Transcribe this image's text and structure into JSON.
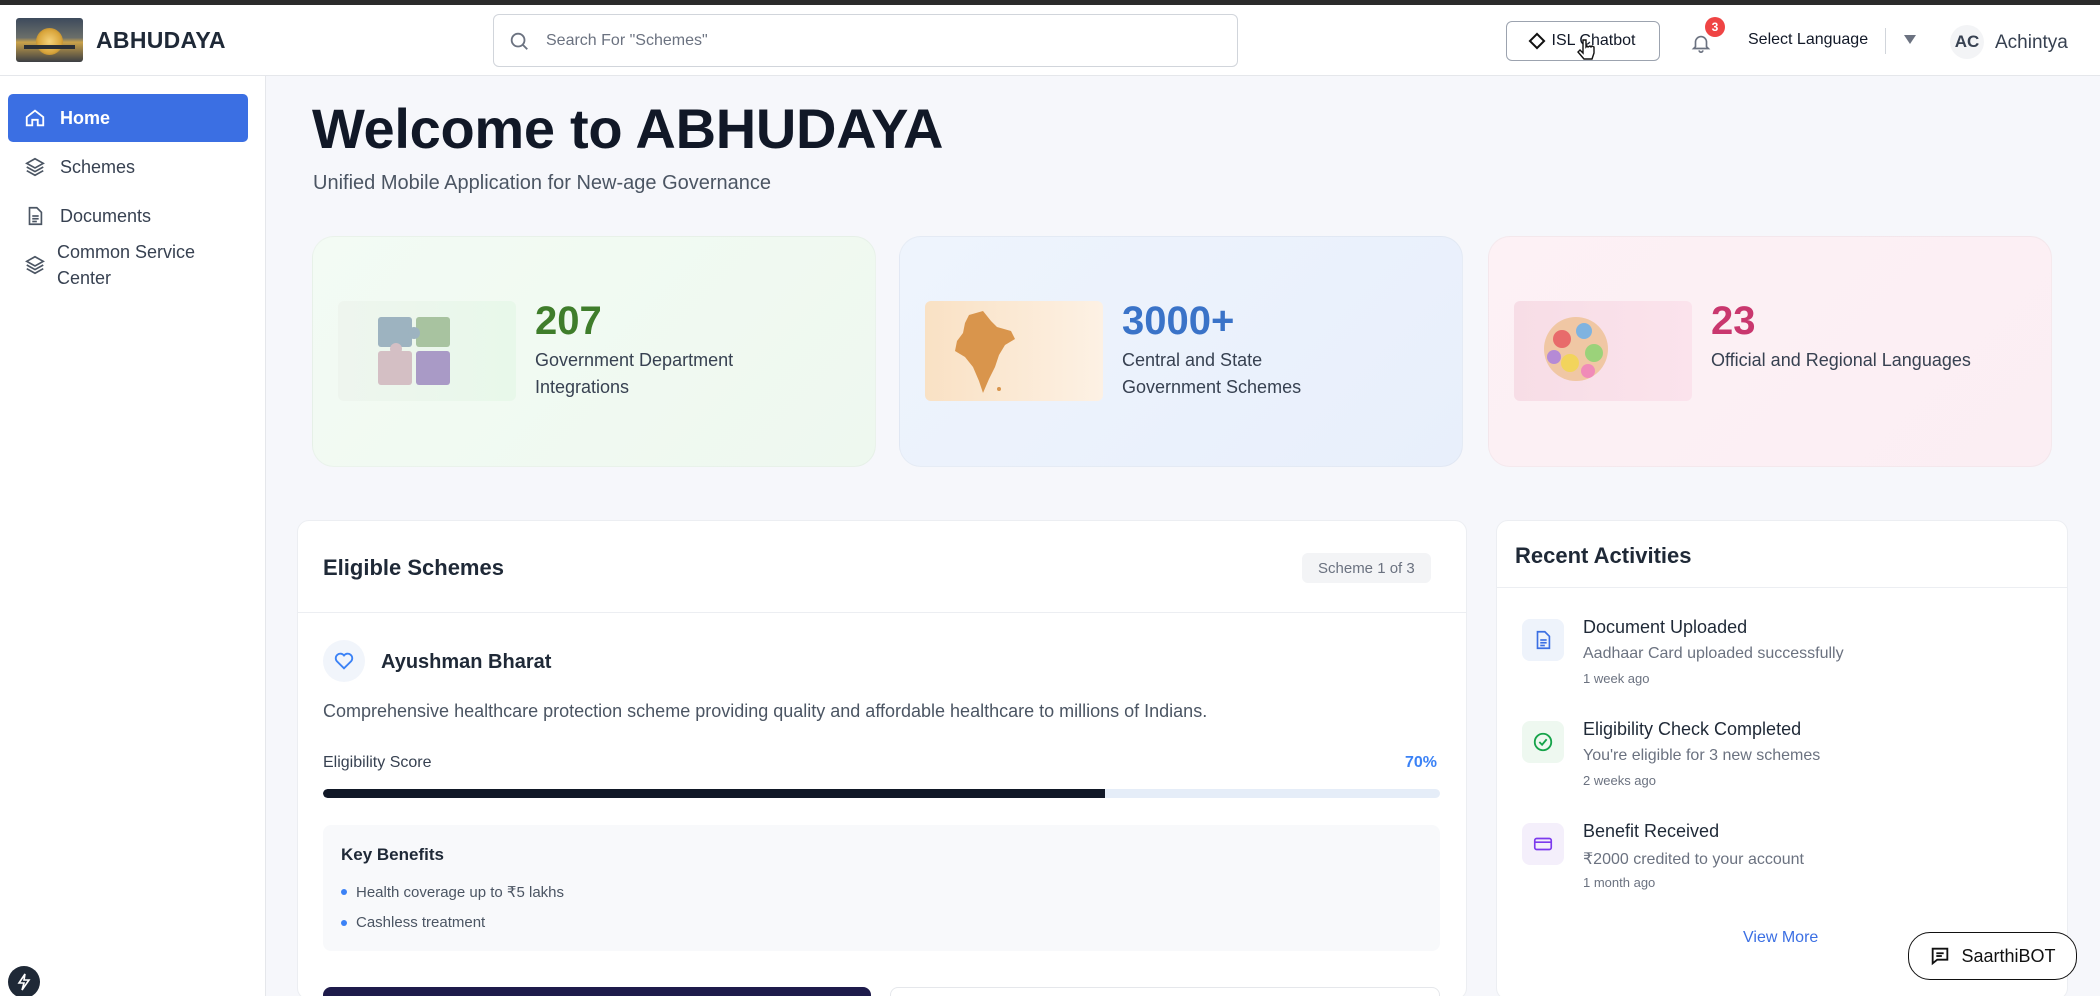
{
  "app": {
    "brand": "ABHUDAYA"
  },
  "header": {
    "search_placeholder": "Search For \"Schemes\"",
    "isl_chatbot_label": "ISL Chatbot",
    "notification_count": "3",
    "language_label": "Select Language",
    "user_initials": "AC",
    "user_name": "Achintya"
  },
  "sidebar": {
    "items": [
      {
        "label": "Home",
        "icon": "home-icon",
        "active": true
      },
      {
        "label": "Schemes",
        "icon": "layers-icon"
      },
      {
        "label": "Documents",
        "icon": "document-icon"
      },
      {
        "label_line1": "Common Service",
        "label_line2": "Center",
        "icon": "layers-icon"
      }
    ]
  },
  "main": {
    "welcome_title": "Welcome to ABHUDAYA",
    "tagline": "Unified Mobile Application for New-age Governance",
    "stats": [
      {
        "value": "207",
        "desc_line1": "Government Department",
        "desc_line2": "Integrations",
        "color": "#3f7d2b",
        "image": "puzzle-pieces"
      },
      {
        "value": "3000+",
        "desc_line1": "Central and State",
        "desc_line2": "Government Schemes",
        "color": "#3a73c8",
        "image": "india-map"
      },
      {
        "value": "23",
        "desc_line1": "Official and Regional Languages",
        "desc_line2": "",
        "color": "#c9376e",
        "image": "speech-bubbles"
      }
    ]
  },
  "eligible": {
    "title": "Eligible Schemes",
    "pager": "Scheme 1 of 3",
    "scheme_name": "Ayushman Bharat",
    "scheme_desc": "Comprehensive healthcare protection scheme providing quality and affordable healthcare to millions of Indians.",
    "score_label": "Eligibility Score",
    "score_value": "70%",
    "score_fraction": 0.7,
    "benefits_title": "Key Benefits",
    "benefits": [
      "Health coverage up to ₹5 lakhs",
      "Cashless treatment"
    ]
  },
  "recent": {
    "title": "Recent Activities",
    "items": [
      {
        "title": "Document Uploaded",
        "subtitle": "Aadhaar Card uploaded successfully",
        "time": "1 week ago",
        "icon": "document-icon",
        "color": "#3b6fe3"
      },
      {
        "title": "Eligibility Check Completed",
        "subtitle": "You're eligible for 3 new schemes",
        "time": "2 weeks ago",
        "icon": "check-circle-icon",
        "color": "#16a34a"
      },
      {
        "title": "Benefit Received",
        "subtitle": "₹2000 credited to your account",
        "time": "1 month ago",
        "icon": "credit-card-icon",
        "color": "#7c3aed"
      }
    ],
    "view_more": "View More"
  },
  "saarthi_bot": {
    "label": "SaarthiBOT"
  },
  "colors": {
    "accent": "#3b6fe3",
    "dark": "#111827"
  }
}
